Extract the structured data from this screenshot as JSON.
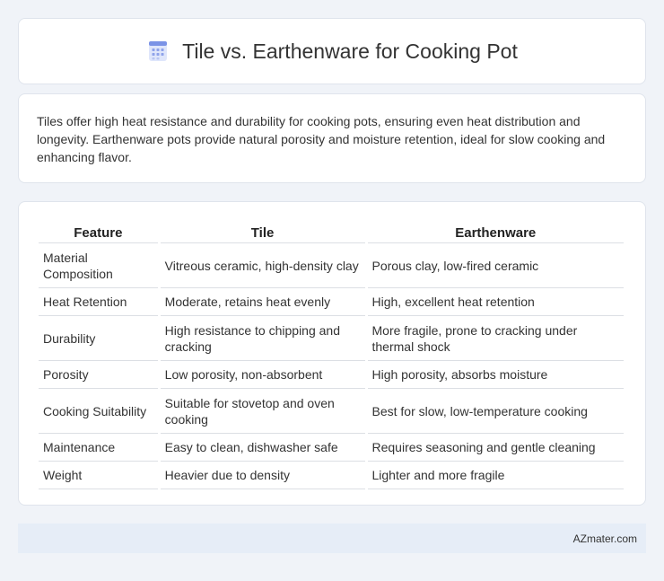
{
  "header": {
    "title": "Tile vs. Earthenware for Cooking Pot",
    "icon": "document-grid-icon",
    "accent": "#7b93e6"
  },
  "intro": {
    "text": "Tiles offer high heat resistance and durability for cooking pots, ensuring even heat distribution and longevity. Earthenware pots provide natural porosity and moisture retention, ideal for slow cooking and enhancing flavor."
  },
  "table": {
    "headers": [
      "Feature",
      "Tile",
      "Earthenware"
    ],
    "rows": [
      [
        "Material Composition",
        "Vitreous ceramic, high-density clay",
        "Porous clay, low-fired ceramic"
      ],
      [
        "Heat Retention",
        "Moderate, retains heat evenly",
        "High, excellent heat retention"
      ],
      [
        "Durability",
        "High resistance to chipping and cracking",
        "More fragile, prone to cracking under thermal shock"
      ],
      [
        "Porosity",
        "Low porosity, non-absorbent",
        "High porosity, absorbs moisture"
      ],
      [
        "Cooking Suitability",
        "Suitable for stovetop and oven cooking",
        "Best for slow, low-temperature cooking"
      ],
      [
        "Maintenance",
        "Easy to clean, dishwasher safe",
        "Requires seasoning and gentle cleaning"
      ],
      [
        "Weight",
        "Heavier due to density",
        "Lighter and more fragile"
      ]
    ]
  },
  "footer": {
    "text": "AZmater.com"
  }
}
